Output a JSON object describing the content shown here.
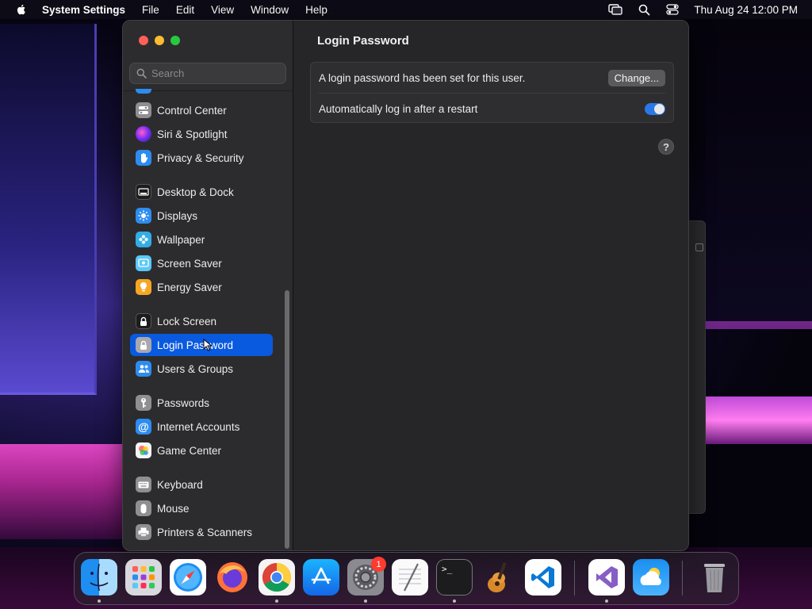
{
  "menubar": {
    "app_name": "System Settings",
    "menus": [
      "File",
      "Edit",
      "View",
      "Window",
      "Help"
    ],
    "clock": "Thu Aug 24  12:00 PM"
  },
  "sidebar": {
    "search_placeholder": "Search",
    "items": [
      {
        "label": "Control Center",
        "icon": "control-center-icon",
        "color": "#8e8e93"
      },
      {
        "label": "Siri & Spotlight",
        "icon": "siri-icon",
        "color": "#a23bd1"
      },
      {
        "label": "Privacy & Security",
        "icon": "hand-icon",
        "color": "#2d8cf0"
      },
      {
        "label": "Desktop & Dock",
        "icon": "dock-icon",
        "color": "#1c1c1e"
      },
      {
        "label": "Displays",
        "icon": "sun-icon",
        "color": "#2d8cf0"
      },
      {
        "label": "Wallpaper",
        "icon": "flower-icon",
        "color": "#32ade6"
      },
      {
        "label": "Screen Saver",
        "icon": "screen-saver-icon",
        "color": "#5ac8fa"
      },
      {
        "label": "Energy Saver",
        "icon": "bulb-icon",
        "color": "#f5a623"
      },
      {
        "label": "Lock Screen",
        "icon": "lock-icon",
        "color": "#1c1c1e"
      },
      {
        "label": "Login Password",
        "icon": "padlock-icon",
        "color": "#8e8e93"
      },
      {
        "label": "Users & Groups",
        "icon": "users-icon",
        "color": "#2d8cf0"
      },
      {
        "label": "Passwords",
        "icon": "key-icon",
        "color": "#8e8e93"
      },
      {
        "label": "Internet Accounts",
        "icon": "at-icon",
        "color": "#2d8cf0"
      },
      {
        "label": "Game Center",
        "icon": "game-center-icon",
        "color": "#f0f0f0"
      },
      {
        "label": "Keyboard",
        "icon": "keyboard-icon",
        "color": "#8e8e93"
      },
      {
        "label": "Mouse",
        "icon": "mouse-icon",
        "color": "#8e8e93"
      },
      {
        "label": "Printers & Scanners",
        "icon": "printer-icon",
        "color": "#8e8e93"
      }
    ],
    "selected": "Login Password"
  },
  "main": {
    "title": "Login Password",
    "password_status": "A login password has been set for this user.",
    "change_button": "Change...",
    "auto_login_label": "Automatically log in after a restart",
    "auto_login_enabled": true,
    "help": "?"
  },
  "dock": {
    "apps": [
      "Finder",
      "Launchpad",
      "Safari",
      "Firefox",
      "Chrome",
      "App Store",
      "System Settings",
      "TextEdit",
      "Terminal",
      "GarageBand",
      "Visual Studio Code",
      "Visual Studio",
      "Weather",
      "Trash"
    ],
    "settings_badge": "1"
  }
}
